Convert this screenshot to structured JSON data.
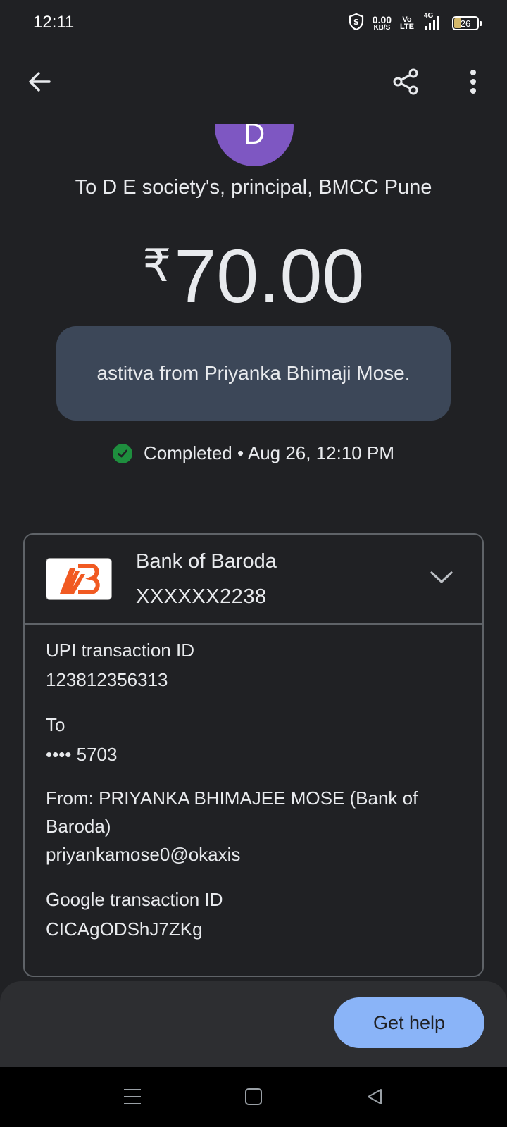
{
  "status_bar": {
    "time": "12:11",
    "net_speed_value": "0.00",
    "net_speed_unit": "KB/S",
    "volte_top": "Vo",
    "volte_bottom": "LTE",
    "network_type": "4G",
    "battery_level": "26"
  },
  "top_bar": {
    "back_icon": "arrow-left-icon",
    "share_icon": "share-icon",
    "more_icon": "more-vert-icon"
  },
  "payee": {
    "avatar_initial": "D",
    "avatar_color": "#7e57c2",
    "title": "To D E society's, principal, BMCC Pune"
  },
  "amount": {
    "currency_symbol": "₹",
    "value": "70.00"
  },
  "note": "astitva from Priyanka Bhimaji Mose.",
  "transaction_status": {
    "text": "Completed • Aug 26, 12:10 PM",
    "color": "#1e8e3e"
  },
  "bank": {
    "name": "Bank of Baroda",
    "account": "XXXXXX2238",
    "logo_color": "#f15a22"
  },
  "details": {
    "upi_label": "UPI transaction ID",
    "upi_value": "123812356313",
    "to_label": "To",
    "to_value": "•••• 5703",
    "from_label": "From: PRIYANKA BHIMAJEE MOSE (Bank of Baroda)",
    "from_value": "priyankamose0@okaxis",
    "google_label": "Google transaction ID",
    "google_value": "CICAgODShJ7ZKg"
  },
  "actions": {
    "get_help": "Get help",
    "accent": "#8ab4f8"
  }
}
